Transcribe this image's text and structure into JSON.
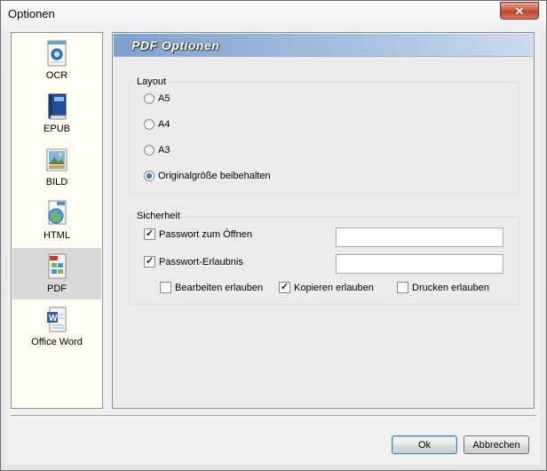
{
  "window": {
    "title": "Optionen",
    "close_label": "✕"
  },
  "sidebar": {
    "items": [
      {
        "label": "OCR",
        "icon": "ocr-document-icon"
      },
      {
        "label": "EPUB",
        "icon": "epub-book-icon"
      },
      {
        "label": "BILD",
        "icon": "image-icon"
      },
      {
        "label": "HTML",
        "icon": "html-globe-icon"
      },
      {
        "label": "PDF",
        "icon": "pdf-document-icon",
        "selected": true
      },
      {
        "label": "Office Word",
        "icon": "word-document-icon"
      }
    ]
  },
  "pane": {
    "title": "PDF Optionen",
    "layout": {
      "legend": "Layout",
      "options": [
        {
          "label": "A5",
          "checked": false
        },
        {
          "label": "A4",
          "checked": false
        },
        {
          "label": "A3",
          "checked": false
        },
        {
          "label": "Originalgröße beibehalten",
          "checked": true
        }
      ]
    },
    "security": {
      "legend": "Sicherheit",
      "open_password": {
        "label": "Passwort zum Öffnen",
        "checked": true,
        "value": ""
      },
      "permission_password": {
        "label": "Passwort-Erlaubnis",
        "checked": true,
        "value": ""
      },
      "permissions": [
        {
          "label": "Bearbeiten erlauben",
          "checked": false
        },
        {
          "label": "Kopieren erlauben",
          "checked": true
        },
        {
          "label": "Drucken erlauben",
          "checked": false
        }
      ]
    }
  },
  "footer": {
    "ok_label": "Ok",
    "cancel_label": "Abbrechen"
  },
  "colors": {
    "header_gradient_start": "#7ea2cf",
    "close_red": "#c0402a",
    "selected_item": "#d9d9d9"
  }
}
